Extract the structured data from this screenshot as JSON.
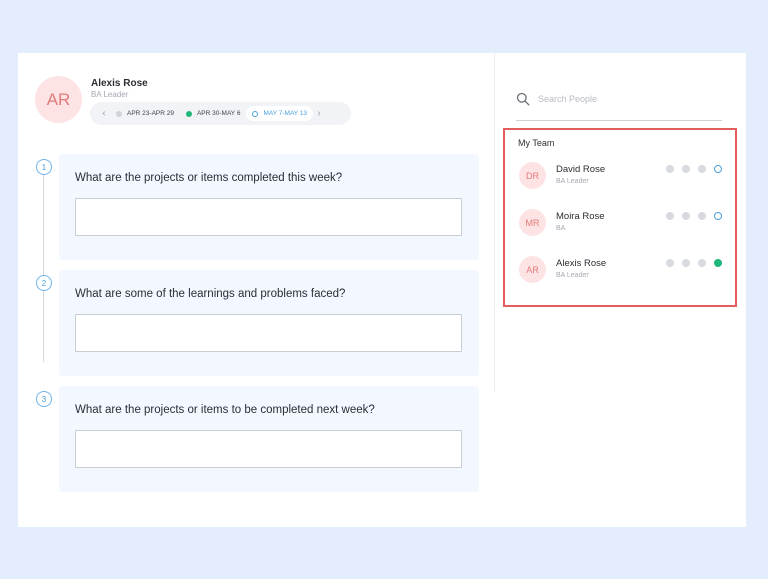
{
  "profile": {
    "initials": "AR",
    "name": "Alexis Rose",
    "role": "BA Leader"
  },
  "weeks": [
    {
      "label": "APR 23-APR 29",
      "status": "grey"
    },
    {
      "label": "APR 30-MAY 6",
      "status": "green"
    },
    {
      "label": "MAY 7-MAY 13",
      "status": "current"
    }
  ],
  "questions": [
    {
      "number": "1",
      "text": "What are the projects or items completed this week?",
      "answer": ""
    },
    {
      "number": "2",
      "text": "What are some of the learnings and problems faced?",
      "answer": ""
    },
    {
      "number": "3",
      "text": "What are the projects or items to be completed next week?",
      "answer": ""
    }
  ],
  "search": {
    "placeholder": "Search People",
    "value": ""
  },
  "team": {
    "title": "My Team",
    "members": [
      {
        "initials": "DR",
        "name": "David Rose",
        "role": "BA Leader",
        "status_dots": [
          "grey",
          "grey",
          "grey",
          "current"
        ]
      },
      {
        "initials": "MR",
        "name": "Moira Rose",
        "role": "BA",
        "status_dots": [
          "grey",
          "grey",
          "grey",
          "current"
        ]
      },
      {
        "initials": "AR",
        "name": "Alexis Rose",
        "role": "BA Leader",
        "status_dots": [
          "grey",
          "grey",
          "grey",
          "done"
        ]
      }
    ]
  },
  "colors": {
    "background": "#e4edfc",
    "accent_blue": "#4aa0dc",
    "status_green": "#1fb87a",
    "highlight_red": "#e35e5e",
    "avatar_bg": "#fde3e3"
  }
}
